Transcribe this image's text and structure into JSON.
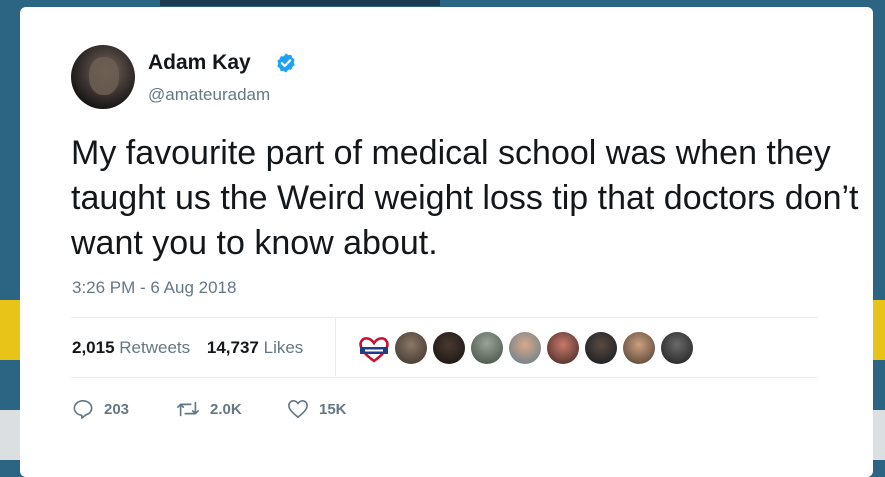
{
  "user": {
    "name": "Adam Kay",
    "handle": "@amateuradam",
    "verified_icon": "verified-badge-icon"
  },
  "tweet": {
    "text": "My favourite part of medical school was when they taught us the Weird weight loss tip that doctors don’t want you to know about.",
    "timestamp": "3:26 PM - 6 Aug 2018"
  },
  "stats": {
    "retweets_count": "2,015",
    "retweets_label": "Retweets",
    "likes_count": "14,737",
    "likes_label": "Likes"
  },
  "actions": {
    "reply_count": "203",
    "retweet_count": "2.0K",
    "like_count": "15K"
  },
  "liker_avatars": [
    "heart-logo",
    "avatar-1",
    "avatar-2",
    "avatar-3",
    "avatar-4",
    "avatar-5",
    "avatar-6",
    "avatar-7",
    "avatar-8"
  ],
  "colors": {
    "accent": "#1da1f2",
    "text": "#14171a",
    "secondary": "#657786",
    "background": "#2c6484"
  }
}
